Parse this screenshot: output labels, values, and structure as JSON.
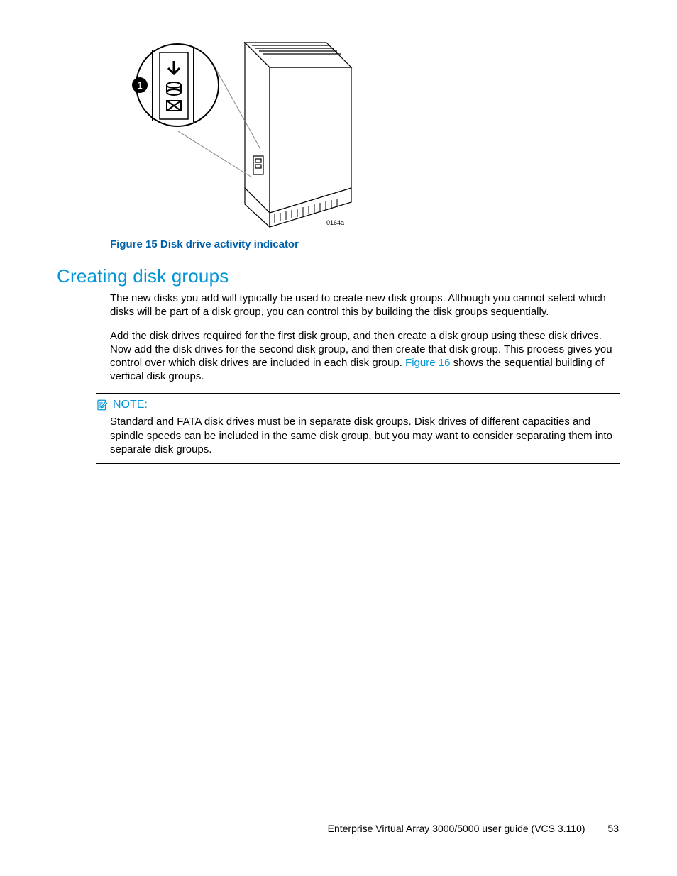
{
  "figure": {
    "caption_label": "Figure 15",
    "caption_title": "Disk drive activity indicator",
    "callout_number": "1",
    "ref_code": "0164a"
  },
  "section": {
    "heading": "Creating disk groups",
    "paragraph1": "The new disks you add will typically be used to create new disk groups. Although you cannot select which disks will be part of a disk group, you can control this by building the disk groups sequentially.",
    "paragraph2_a": "Add the disk drives required for the first disk group, and then create a disk group using these disk drives. Now add the disk drives for the second disk group, and then create that disk group. This process gives you control over which disk drives are included in each disk group. ",
    "paragraph2_link": "Figure 16",
    "paragraph2_b": " shows the sequential building of vertical disk groups."
  },
  "note": {
    "label": "NOTE:",
    "body": "Standard and FATA disk drives must be in separate disk groups. Disk drives of different capacities and spindle speeds can be included in the same disk group, but you may want to consider separating them into separate disk groups."
  },
  "footer": {
    "title": "Enterprise Virtual Array 3000/5000 user guide (VCS 3.110)",
    "page_number": "53"
  }
}
